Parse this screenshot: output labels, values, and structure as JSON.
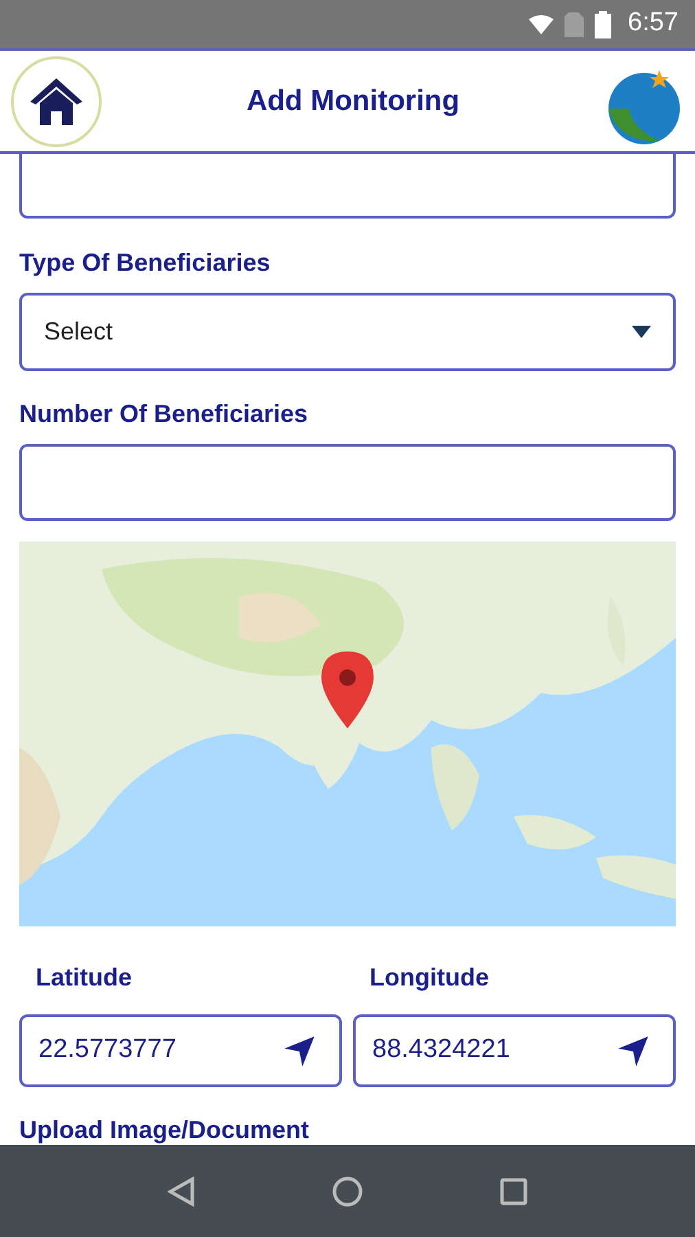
{
  "status_bar": {
    "time": "6:57"
  },
  "header": {
    "title": "Add Monitoring"
  },
  "fields": [
    {
      "kind": "select",
      "label": "Type Of Beneficiaries",
      "value": "Select"
    },
    {
      "kind": "text",
      "label": "Number Of Beneficiaries"
    }
  ],
  "coordinates": [
    {
      "label": "Latitude",
      "value": "22.5773777"
    },
    {
      "label": "Longitude",
      "value": "88.4324221"
    }
  ],
  "upload": {
    "label": "Upload Image/Document"
  }
}
